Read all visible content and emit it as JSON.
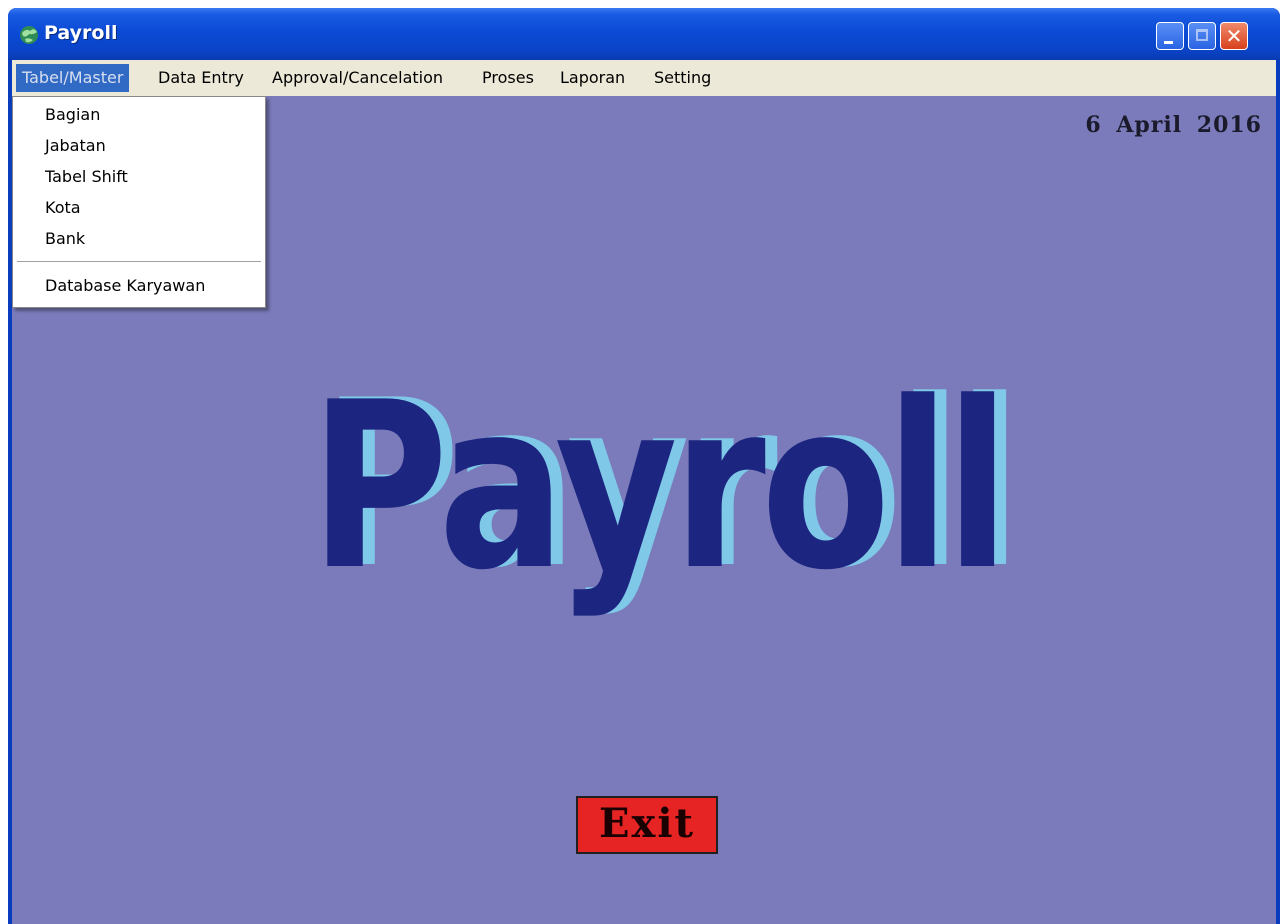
{
  "window": {
    "title": "Payroll",
    "controls": {
      "minimize": "minimize-icon",
      "maximize": "maximize-icon",
      "close": "close-icon",
      "close_glyph": "✕"
    }
  },
  "menubar": {
    "items": [
      {
        "label": "Tabel/Master",
        "active": true
      },
      {
        "label": "Data Entry"
      },
      {
        "label": "Approval/Cancelation"
      },
      {
        "label": "Proses"
      },
      {
        "label": "Laporan"
      },
      {
        "label": "Setting"
      }
    ]
  },
  "dropdown": {
    "items": [
      {
        "label": "Bagian"
      },
      {
        "label": "Jabatan"
      },
      {
        "label": "Tabel Shift"
      },
      {
        "label": "Kota"
      },
      {
        "label": "Bank"
      },
      {
        "label": "Database Karyawan"
      }
    ]
  },
  "main": {
    "date": "6 April 2016",
    "logo_text": "Payroll",
    "exit_label": "Exit"
  },
  "colors": {
    "titlebar": "#0b4bd6",
    "menubar": "#ece9d8",
    "menu_active": "#316ac5",
    "client_bg": "#7b7bbb",
    "logo": "#1c2680",
    "logo_shadow": "#7fc8e8",
    "exit_bg": "#e62424"
  }
}
